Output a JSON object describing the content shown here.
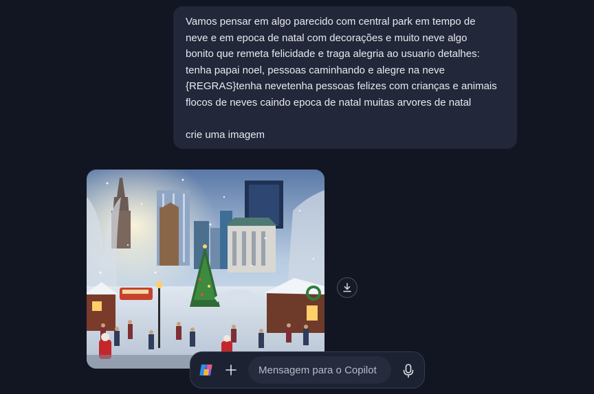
{
  "user_message": {
    "lines": [
      "Vamos pensar em algo parecido com central park em tempo de",
      "neve e em epoca de natal com decorações e muito neve algo",
      "bonito que remeta felicidade e traga alegria ao usuario detalhes:",
      "tenha papai noel, pessoas caminhando e alegre na neve",
      "{REGRAS}tenha nevetenha pessoas felizes com crianças e animais",
      "flocos de neves caindo epoca de natal muitas arvores de natal",
      "crie uma imagem"
    ]
  },
  "generated_image": {
    "subject": "snowy Central Park Christmas scene"
  },
  "download": {
    "icon": "download-icon"
  },
  "composer": {
    "copilot_icon": "copilot-logo-icon",
    "add_icon": "plus-icon",
    "placeholder": "Mensagem para o Copilot",
    "mic_icon": "microphone-icon"
  },
  "colors": {
    "background": "#121623",
    "bubble": "#222739",
    "text": "#e9eaf0"
  }
}
